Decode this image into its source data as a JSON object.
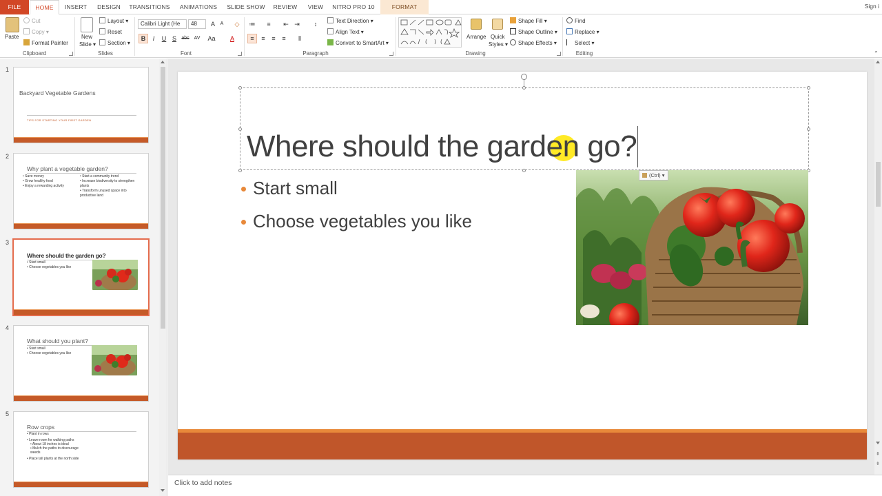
{
  "tabs": [
    "FILE",
    "HOME",
    "INSERT",
    "DESIGN",
    "TRANSITIONS",
    "ANIMATIONS",
    "SLIDE SHOW",
    "REVIEW",
    "VIEW",
    "NITRO PRO 10",
    "FORMAT"
  ],
  "account": {
    "signin": "Sign i"
  },
  "ribbon": {
    "clipboard": {
      "paste": "Paste",
      "cut": "Cut",
      "copy": "Copy",
      "format_painter": "Format Painter",
      "label": "Clipboard"
    },
    "slides": {
      "new_slide": "New",
      "new_slide2": "Slide",
      "layout": "Layout",
      "reset": "Reset",
      "section": "Section",
      "label": "Slides"
    },
    "font": {
      "name": "Calibri Light (He",
      "size": "48",
      "label": "Font"
    },
    "paragraph": {
      "text_direction": "Text Direction",
      "align_text": "Align Text",
      "convert": "Convert to SmartArt",
      "label": "Paragraph"
    },
    "drawing": {
      "arrange": "Arrange",
      "quick": "Quick",
      "styles": "Styles",
      "shape_fill": "Shape Fill",
      "shape_outline": "Shape Outline",
      "shape_effects": "Shape Effects",
      "label": "Drawing"
    },
    "editing": {
      "find": "Find",
      "replace": "Replace",
      "select": "Select",
      "label": "Editing"
    }
  },
  "thumbnails": [
    {
      "num": "1",
      "title": "Backyard Vegetable Gardens",
      "subtitle": "TIPS FOR STARTING YOUR FIRST GARDEN"
    },
    {
      "num": "2",
      "title": "Why plant a vegetable garden?",
      "left": [
        "Save money",
        "Grow healthy food",
        "Enjoy a rewarding activity"
      ],
      "right": [
        "Start a community trend",
        "Increase biodiversity to strengthen plants",
        "Transform unused space into productive land"
      ]
    },
    {
      "num": "3",
      "title": "Where should the garden go?",
      "bullets": [
        "Start small",
        "Choose vegetables you like"
      ]
    },
    {
      "num": "4",
      "title": "What should you plant?",
      "bullets": [
        "Start small",
        "Choose vegetables you like"
      ]
    },
    {
      "num": "5",
      "title": "Row crops",
      "bullets": [
        "Plant in rows",
        "Leave room for walking paths",
        "About 18 inches is ideal",
        "Mulch the paths to discourage weeds",
        "Place tall plants at the north side"
      ]
    }
  ],
  "slide": {
    "title": "Where should the garden go?",
    "bullets": [
      "Start small",
      "Choose vegetables you like"
    ],
    "paste_options": "(Ctrl)"
  },
  "notes": {
    "placeholder": "Click to add notes"
  },
  "colors": {
    "accent": "#d24726",
    "bar": "#c0562a",
    "bullet": "#e8893a"
  }
}
